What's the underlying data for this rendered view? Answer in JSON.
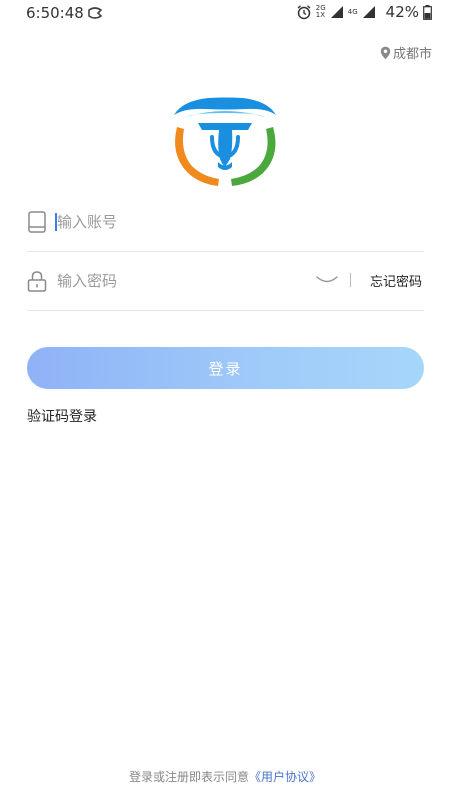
{
  "status_bar": {
    "time": "6:50:48",
    "battery": "42%",
    "network_1": "2G 1X",
    "network_2": "4G",
    "icons": [
      "alarm-icon",
      "signal-icon",
      "battery-icon"
    ]
  },
  "location": {
    "city": "成都市"
  },
  "account_field": {
    "placeholder": "输入账号",
    "value": ""
  },
  "password_field": {
    "placeholder": "输入密码",
    "value": ""
  },
  "forgot_password_label": "忘记密码",
  "login_button_label": "登录",
  "sms_login_label": "验证码登录",
  "agreement": {
    "text": "登录或注册即表示同意",
    "link": "《用户协议》"
  },
  "colors": {
    "accent": "#3b7cf4",
    "button_gradient_start": "#8fb2f7",
    "button_gradient_end": "#a7d6fb",
    "logo_blue": "#1a8fe0",
    "logo_orange": "#f08a1c",
    "logo_green": "#4aa83c",
    "link": "#4a74c9"
  }
}
